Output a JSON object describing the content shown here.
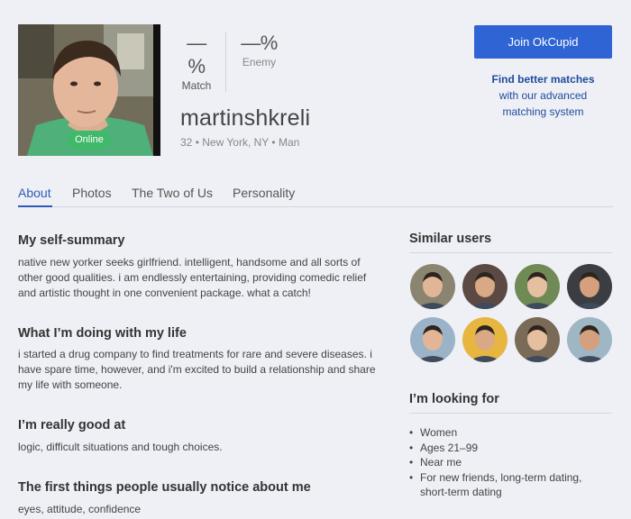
{
  "profile": {
    "username": "martinshkreli",
    "age": "32",
    "location": "New York, NY",
    "gender": "Man",
    "online_label": "Online",
    "match_pct": "—%",
    "match_label": "Match",
    "enemy_pct": "—%",
    "enemy_label": "Enemy"
  },
  "cta": {
    "join_label": "Join OkCupid",
    "promo_line1": "Find better matches",
    "promo_line2": "with our advanced",
    "promo_line3": "matching system"
  },
  "tabs": [
    {
      "label": "About",
      "active": true
    },
    {
      "label": "Photos",
      "active": false
    },
    {
      "label": "The Two of Us",
      "active": false
    },
    {
      "label": "Personality",
      "active": false
    }
  ],
  "essays": [
    {
      "heading": "My self-summary",
      "text": "native new yorker seeks girlfriend. intelligent, handsome and all sorts of other good qualities. i am endlessly entertaining, providing comedic relief and artistic thought in one convenient package. what a catch!"
    },
    {
      "heading": "What I’m doing with my life",
      "text": "i started a drug company to find treatments for rare and severe diseases. i have spare time, however, and i'm excited to build a relationship and share my life with someone."
    },
    {
      "heading": "I’m really good at",
      "text": "logic, difficult situations and tough choices."
    },
    {
      "heading": "The first things people usually notice about me",
      "text": "eyes, attitude, confidence"
    }
  ],
  "sidebar": {
    "similar_heading": "Similar users",
    "similar_users": [
      {
        "name": "similar-user-1",
        "bg": "#8a8470"
      },
      {
        "name": "similar-user-2",
        "bg": "#5b4a44"
      },
      {
        "name": "similar-user-3",
        "bg": "#6f8a55"
      },
      {
        "name": "similar-user-4",
        "bg": "#3a3d42"
      },
      {
        "name": "similar-user-5",
        "bg": "#9bb3c9"
      },
      {
        "name": "similar-user-6",
        "bg": "#e7b640"
      },
      {
        "name": "similar-user-7",
        "bg": "#7a6a58"
      },
      {
        "name": "similar-user-8",
        "bg": "#9fb6c4"
      }
    ],
    "looking_heading": "I’m looking for",
    "looking_for": [
      "Women",
      "Ages 21–99",
      "Near me",
      "For new friends, long-term dating, short-term dating"
    ]
  },
  "colors": {
    "accent": "#2f64d4",
    "online": "#41b96a",
    "background": "#eef0f6"
  }
}
